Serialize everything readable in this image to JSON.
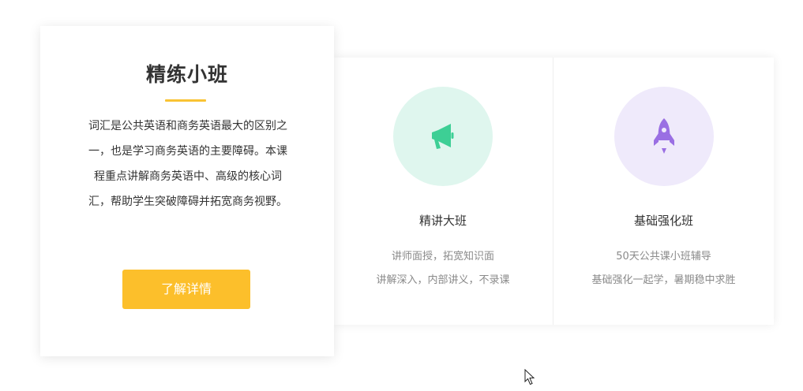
{
  "featured": {
    "title": "精练小班",
    "description": "词汇是公共英语和商务英语最大的区别之一，也是学习商务英语的主要障碍。本课程重点讲解商务英语中、高级的核心词汇，帮助学生突破障碍并拓宽商务视野。",
    "button_label": "了解详情",
    "accent_color": "#fcbf2b"
  },
  "cards": [
    {
      "title": "精讲大班",
      "icon": "megaphone-icon",
      "icon_color": "#3dcf95",
      "circle_color": "#dff6ee",
      "line1": "讲师面授，拓宽知识面",
      "line2": "讲解深入，内部讲义，不录课"
    },
    {
      "title": "基础强化班",
      "icon": "rocket-icon",
      "icon_color": "#9a6fe3",
      "circle_color": "#efeafb",
      "line1": "50天公共课小班辅导",
      "line2": "基础强化一起学，暑期稳中求胜"
    }
  ]
}
